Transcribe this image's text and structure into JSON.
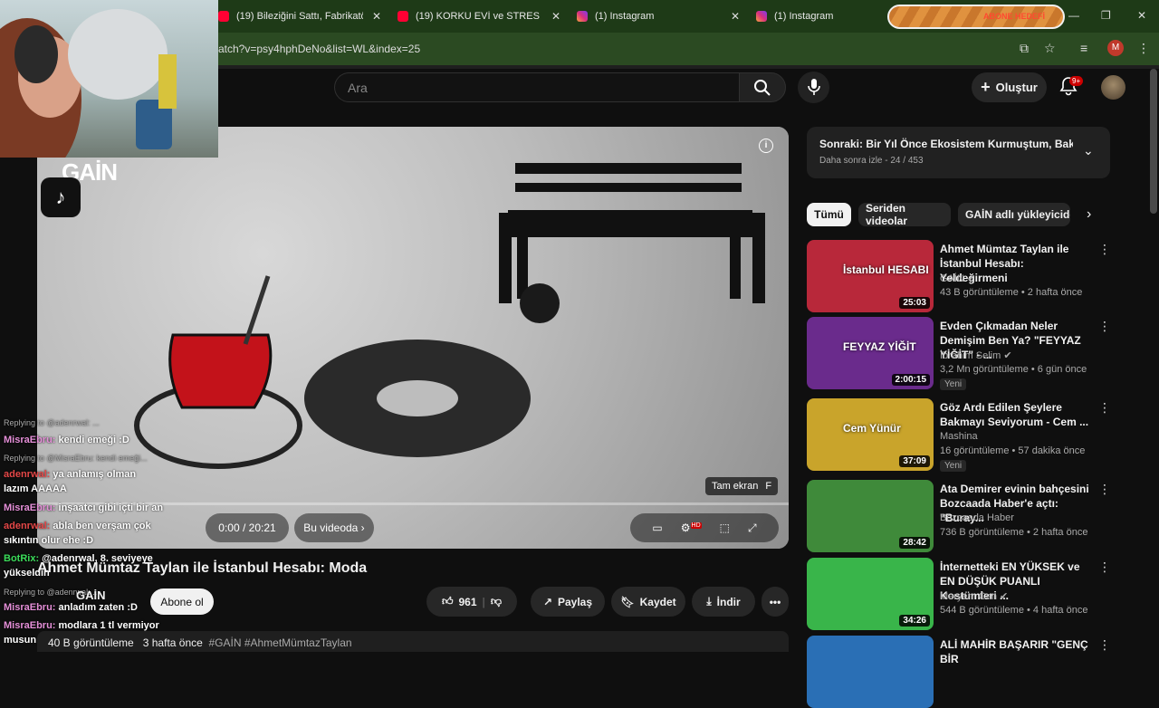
{
  "tabs": [
    {
      "title": "(19) Bileziğini Sattı, Fabrikatör O",
      "icon": "youtube-icon"
    },
    {
      "title": "(19) KORKU EVİ ve STRES ODAS",
      "icon": "youtube-icon"
    },
    {
      "title": "(1) Instagram",
      "icon": "instagram-icon"
    },
    {
      "title": "(1) Instagram",
      "icon": "instagram-icon"
    }
  ],
  "promo_text": "ABONE HEDEFİ",
  "address": "atch?v=psy4hphDeNo&list=WL&index=25",
  "profile_letter": "M",
  "search": {
    "placeholder": "Ara"
  },
  "header": {
    "create_label": "Oluştur",
    "notifications": "9+"
  },
  "overlay": {
    "gain_logo": "GAİN"
  },
  "chat": [
    {
      "reply": "Replying to @adenrwal: ...",
      "user": "",
      "msg": "",
      "type": "reply"
    },
    {
      "user": "MisraEbru:",
      "msg": "kendi emeği :D",
      "color": "pink"
    },
    {
      "reply": "Replying to @MisraEbru: kendi emeği...",
      "type": "reply"
    },
    {
      "user": "adenrwal:",
      "msg": "ya anlamış olman",
      "color": "red"
    },
    {
      "user": "",
      "msg": "lazım AAAAA",
      "color": ""
    },
    {
      "user": "MisraEbru:",
      "msg": "inşaatcı gibi içti bir an",
      "color": "pink"
    },
    {
      "user": "adenrwal:",
      "msg": "abla ben verşam çok",
      "color": "red"
    },
    {
      "user": "",
      "msg": "sıkıntın olur ehe :D",
      "color": ""
    },
    {
      "user": "BotRix:",
      "msg": "@adenrwal, 8. seviyeye",
      "color": "green"
    },
    {
      "user": "",
      "msg": "yükseldin",
      "color": ""
    },
    {
      "reply": "Replying to @adenrwal: ...",
      "type": "reply"
    },
    {
      "user": "MisraEbru:",
      "msg": "anladım zaten :D",
      "color": "pink"
    },
    {
      "user": "MisraEbru:",
      "msg": "modlara 1 tl vermiyor",
      "color": "pink"
    },
    {
      "user": "",
      "msg": "musun sen merve :D",
      "color": ""
    }
  ],
  "player": {
    "time": "0:00 / 20:21",
    "chapter": "Bu videoda",
    "fullscreen_tip": "Tam ekran",
    "fullscreen_key": "F",
    "hd_badge": "HD"
  },
  "video": {
    "title": "Ahmet Mümtaz Taylan ile İstanbul Hesabı: Moda",
    "channel": "GAİN",
    "subscribe": "Abone ol",
    "likes": "961",
    "share": "Paylaş",
    "save": "Kaydet",
    "download": "İndir",
    "views": "40 B görüntüleme",
    "date": "3 hafta önce",
    "hashtags": "#GAİN #AhmetMümtazTaylan"
  },
  "playlist": {
    "title": "Sonraki: Bir Yıl Önce Ekosistem Kurmuştum, Bakın ...",
    "sub": "Daha sonra izle - 24 / 453"
  },
  "chips": [
    "Tümü",
    "Seriden videolar",
    "GAİN adlı yükleyiciden"
  ],
  "recommendations": [
    {
      "title": "Ahmet Mümtaz Taylan ile İstanbul Hesabı: Yeldeğirmeni",
      "channel": "GAİN",
      "verified": true,
      "meta": "43 B görüntüleme • 2 hafta önce",
      "duration": "25:03",
      "new": "",
      "thumb_text": "İstanbul HESABI",
      "thumb_color": "#b8283a"
    },
    {
      "title": "Evden Çıkmadan Neler Demişim Ben Ya? \"FEYYAZ YİĞİT\" - ...",
      "channel": "İbrahim Selim",
      "verified": true,
      "meta": "3,2 Mn görüntüleme • 6 gün önce",
      "duration": "2:00:15",
      "new": "Yeni",
      "thumb_text": "FEYYAZ YİĞİT",
      "thumb_color": "#6a2b8c"
    },
    {
      "title": "Göz Ardı Edilen Şeylere Bakmayı Seviyorum - Cem ...",
      "channel": "Mashina",
      "verified": false,
      "meta": "16 görüntüleme • 57 dakika önce",
      "duration": "37:09",
      "new": "Yeni",
      "thumb_text": "Cem Yünür",
      "thumb_color": "#c9a42b"
    },
    {
      "title": "Ata Demirer evinin bahçesini Bozcaada Haber'e açtı: \"Buray...",
      "channel": "Bozcaada Haber",
      "verified": false,
      "meta": "736 B görüntüleme • 2 hafta önce",
      "duration": "28:42",
      "new": "",
      "thumb_text": "",
      "thumb_color": "#3f8a3a"
    },
    {
      "title": "İnternetteki EN YÜKSEK ve EN DÜŞÜK PUANLI Kostümleri ...",
      "channel": "Meryem Can",
      "verified": true,
      "meta": "544 B görüntüleme • 4 hafta önce",
      "duration": "34:26",
      "new": "",
      "thumb_text": "",
      "thumb_color": "#39b54a"
    },
    {
      "title": "ALİ MAHİR BAŞARIR \"GENÇ BİR",
      "channel": "",
      "verified": false,
      "meta": "",
      "duration": "",
      "new": "",
      "thumb_text": "",
      "thumb_color": "#2a6fb5"
    }
  ]
}
